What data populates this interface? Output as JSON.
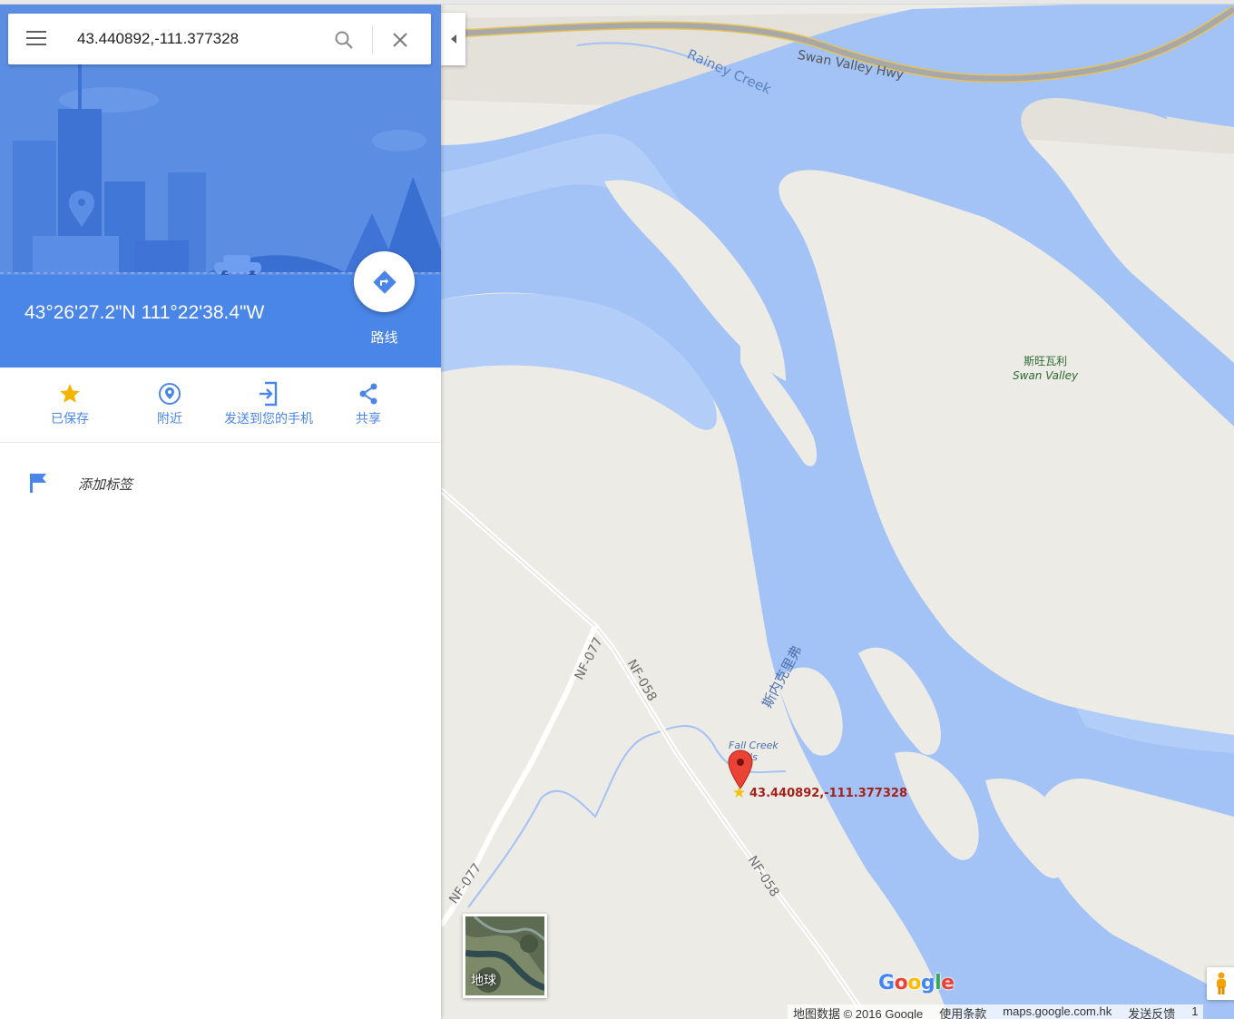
{
  "search": {
    "value": "43.440892,-111.377328",
    "menu_icon": "hamburger-menu-icon",
    "search_icon": "magnifier-icon",
    "close_icon": "close-x-icon"
  },
  "place": {
    "coordinates_dms": "43°26'27.2\"N 111°22'38.4\"W",
    "route_label": "路线"
  },
  "actions": [
    {
      "label": "已保存",
      "icon": "star-icon",
      "color": "#f4b400"
    },
    {
      "label": "附近",
      "icon": "nearby-pin-icon",
      "color": "#4a86e8"
    },
    {
      "label": "发送到您的手机",
      "icon": "send-to-phone-icon",
      "color": "#4a86e8"
    },
    {
      "label": "共享",
      "icon": "share-icon",
      "color": "#4a86e8"
    }
  ],
  "label_row": {
    "text": "添加标签",
    "icon": "flag-icon"
  },
  "map": {
    "labels": {
      "highway": "Swan Valley Hwy",
      "creek": "Rainey Creek",
      "place_cn": "斯旺瓦利",
      "place_en": "Swan Valley",
      "river": "斯内克里弗",
      "falls": "Fall Creek Falls",
      "falls_line1": "Fall Creek",
      "falls_line2": "lls",
      "road_nf077_a": "NF-077",
      "road_nf077_b": "NF-077",
      "road_nf058_a": "NF-058",
      "road_nf058_b": "NF-058",
      "pin_label": "43.440892,-111.377328"
    },
    "earth_toggle": "地球",
    "logo": "Google",
    "footer": {
      "data": "地图数据 © 2016 Google",
      "terms": "使用条款",
      "domain": "maps.google.com.hk",
      "feedback": "发送反馈",
      "scale": "1"
    },
    "colors": {
      "land": "#ecebe5",
      "water": "#a3c2f5",
      "water_light": "#b1cdf8",
      "highway": "#f4d27a",
      "accent": "#4a86e8",
      "pin": "#ea4335"
    }
  }
}
